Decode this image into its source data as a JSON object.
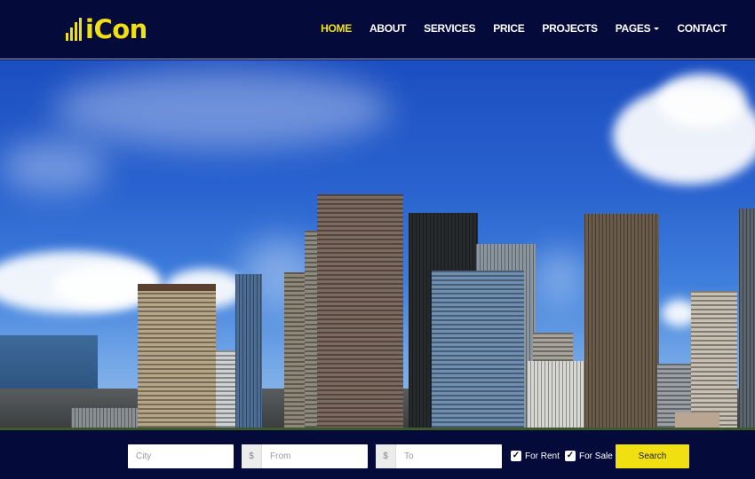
{
  "brand": {
    "name": "iCon",
    "accent_color": "#f0e012",
    "background_color": "#040b3a"
  },
  "nav": {
    "items": [
      {
        "label": "HOME",
        "active": true
      },
      {
        "label": "ABOUT"
      },
      {
        "label": "SERVICES"
      },
      {
        "label": "PRICE"
      },
      {
        "label": "PROJECTS"
      },
      {
        "label": "PAGES",
        "has_dropdown": true
      },
      {
        "label": "CONTACT"
      }
    ]
  },
  "hero": {
    "image_description": "Seattle downtown skyline with skyscrapers under a blue sky with white clouds"
  },
  "search": {
    "city": {
      "placeholder": "City",
      "value": ""
    },
    "price_from": {
      "addon": "$",
      "placeholder": "From",
      "value": ""
    },
    "price_to": {
      "addon": "$",
      "placeholder": "To",
      "value": ""
    },
    "for_rent": {
      "label": "For Rent",
      "checked": true
    },
    "for_sale": {
      "label": "For Sale",
      "checked": true
    },
    "submit_label": "Search"
  }
}
